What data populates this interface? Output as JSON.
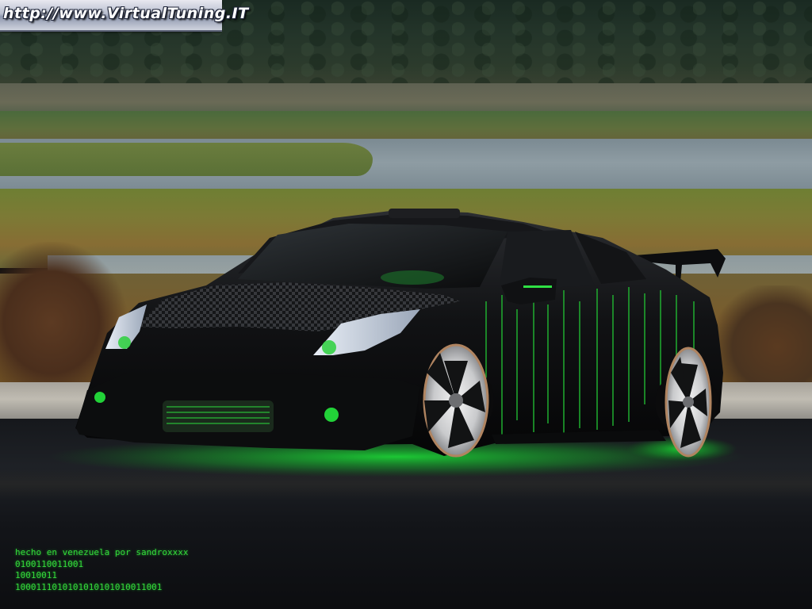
{
  "watermark": {
    "text": "http://www.VirtualTuning.IT"
  },
  "caption": {
    "lines": [
      "hecho en venezuela por sandroxxxx",
      "0100110011001",
      "10010011",
      "1000111010101010101010011001"
    ]
  },
  "colors": {
    "matrix_green": "#34d93a",
    "car_body": "#0d0e10",
    "neon_glow": "#1cff3a"
  }
}
